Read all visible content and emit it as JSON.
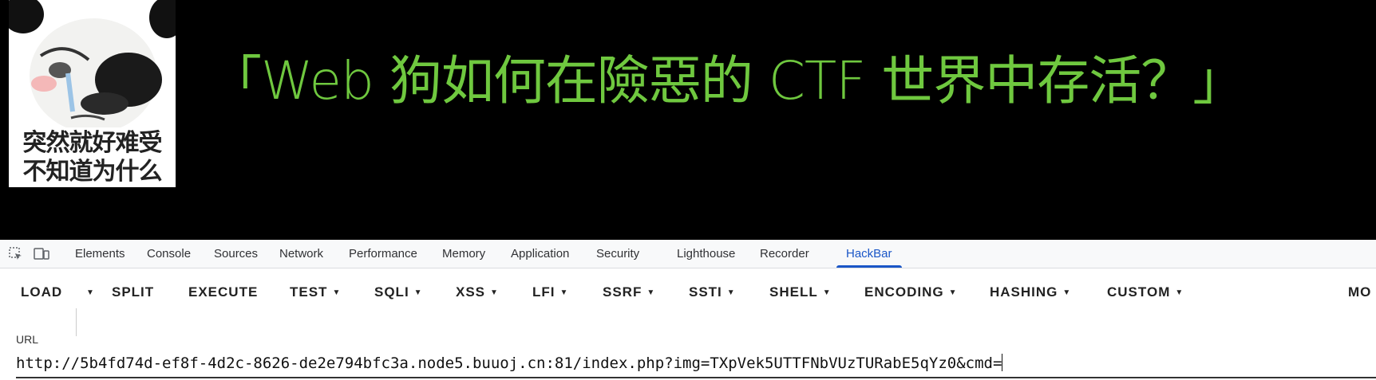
{
  "page": {
    "meme_caption_line1": "突然就好难受",
    "meme_caption_line2": "不知道为什么",
    "headline": "「Web 狗如何在險惡的 CTF 世界中存活？」"
  },
  "devtools": {
    "tabs": [
      {
        "label": "Elements"
      },
      {
        "label": "Console"
      },
      {
        "label": "Sources"
      },
      {
        "label": "Network"
      },
      {
        "label": "Performance"
      },
      {
        "label": "Memory"
      },
      {
        "label": "Application"
      },
      {
        "label": "Security"
      },
      {
        "label": "Lighthouse"
      },
      {
        "label": "Recorder"
      },
      {
        "label": "HackBar",
        "active": true
      }
    ],
    "icons": [
      "inspect-element-icon",
      "device-toolbar-icon"
    ]
  },
  "hackbar": {
    "buttons": [
      {
        "label": "LOAD"
      },
      {
        "label": "SPLIT"
      },
      {
        "label": "EXECUTE"
      },
      {
        "label": "TEST",
        "dropdown": true
      },
      {
        "label": "SQLI",
        "dropdown": true
      },
      {
        "label": "XSS",
        "dropdown": true
      },
      {
        "label": "LFI",
        "dropdown": true
      },
      {
        "label": "SSRF",
        "dropdown": true
      },
      {
        "label": "SSTI",
        "dropdown": true
      },
      {
        "label": "SHELL",
        "dropdown": true
      },
      {
        "label": "ENCODING",
        "dropdown": true
      },
      {
        "label": "HASHING",
        "dropdown": true
      },
      {
        "label": "CUSTOM",
        "dropdown": true
      },
      {
        "label": "MO"
      }
    ],
    "url_label": "URL",
    "url_value": "http://5b4fd74d-ef8f-4d2c-8626-de2e794bfc3a.node5.buuoj.cn:81/index.php?img=TXpVek5UTTFNbVUzTURabE5qYz0&cmd="
  }
}
